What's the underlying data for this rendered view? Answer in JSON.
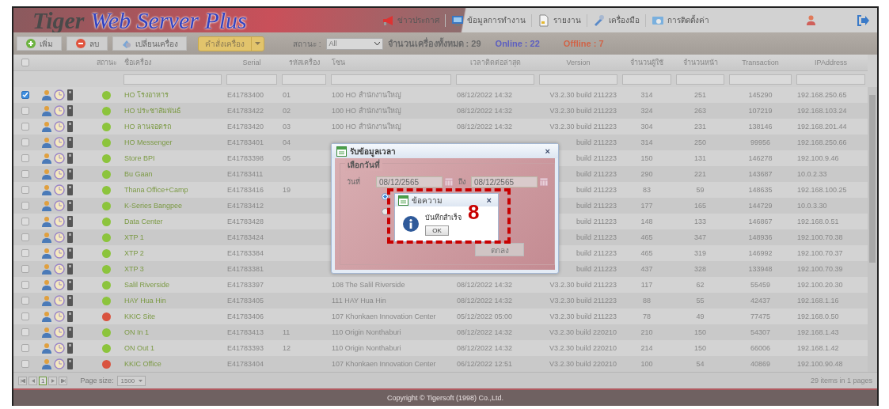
{
  "header": {
    "logo_part1": "Tiger",
    "logo_part2": "Web Server Plus",
    "nav": [
      {
        "label": "ข่าวประกาศ",
        "kind": "megaphone"
      },
      {
        "label": "ข้อมูลการทำงาน",
        "kind": "monitor"
      },
      {
        "label": "รายงาน",
        "kind": "document"
      },
      {
        "label": "เครื่องมือ",
        "kind": "tools"
      },
      {
        "label": "การติดตั้งค่า",
        "kind": "settings"
      }
    ]
  },
  "toolbar": {
    "buttons": [
      {
        "label": "เพิ่ม",
        "kind": "add"
      },
      {
        "label": "ลบ",
        "kind": "remove"
      },
      {
        "label": "เปลี่ยนเครื่อง",
        "kind": "swap"
      }
    ],
    "command_button": "คำสั่งเครื่อง",
    "status_label": "สถานะ :",
    "status_value": "All",
    "total": "จำนวนเครื่องทั้งหมด : 29",
    "online": "Online : 22",
    "offline": "Offline : 7"
  },
  "table": {
    "header_checkbox": {
      "checked": false
    },
    "status_column": "สถานะ",
    "columns": [
      "ชื่อเครื่อง",
      "Serial",
      "รหัสเครื่อง",
      "โซน",
      "เวลาติดต่อล่าสุด",
      "Version",
      "จำนวนผู้ใช้",
      "จำนวนหน้า",
      "Transaction",
      "IPAddress"
    ],
    "rows": [
      {
        "checked": true,
        "color": "#8cc43c",
        "cells": [
          "HO โรงอาหาร",
          "E41783400",
          "01",
          "100 HO สำนักงานใหญ่",
          "08/12/2022 14:32",
          "V3.2.30 build 211223",
          "314",
          "251",
          "145290",
          "192.168.250.65"
        ]
      },
      {
        "checked": false,
        "color": "#8cc43c",
        "cells": [
          "HO ประชาสัมพันธ์",
          "E41783422",
          "02",
          "100 HO สำนักงานใหญ่",
          "08/12/2022 14:32",
          "V3.2.30 build 211223",
          "324",
          "263",
          "107219",
          "192.168.103.24"
        ]
      },
      {
        "checked": false,
        "color": "#8cc43c",
        "cells": [
          "HO ลานจอดรถ",
          "E41783420",
          "03",
          "100 HO สำนักงานใหญ่",
          "08/12/2022 14:32",
          "V3.2.30 build 211223",
          "304",
          "231",
          "138146",
          "192.168.201.44"
        ]
      },
      {
        "checked": false,
        "color": "#8cc43c",
        "cells": [
          "HO Messenger",
          "E41783401",
          "04",
          null,
          null,
          "build 211223",
          "314",
          "250",
          "99956",
          "192.168.250.66"
        ]
      },
      {
        "checked": false,
        "color": "#8cc43c",
        "cells": [
          "Store BPI",
          "E41783398",
          "05",
          null,
          null,
          "build 211223",
          "150",
          "131",
          "146278",
          "192.100.9.46"
        ]
      },
      {
        "checked": false,
        "color": "#8cc43c",
        "cells": [
          "Bu Gaan",
          "E41783411",
          null,
          null,
          null,
          "build 211223",
          "290",
          "221",
          "143687",
          "10.0.2.33"
        ]
      },
      {
        "checked": false,
        "color": "#8cc43c",
        "cells": [
          "Thana Office+Camp",
          "E41783416",
          "19",
          null,
          null,
          "build 211223",
          "83",
          "59",
          "148635",
          "192.168.100.25"
        ]
      },
      {
        "checked": false,
        "color": "#8cc43c",
        "cells": [
          "K-Series Bangpee",
          "E41783412",
          null,
          null,
          null,
          "build 211223",
          "177",
          "165",
          "144729",
          "10.0.3.30"
        ]
      },
      {
        "checked": false,
        "color": "#8cc43c",
        "cells": [
          "Data Center",
          "E41783428",
          null,
          null,
          null,
          "build 211223",
          "148",
          "133",
          "146867",
          "192.168.0.51"
        ]
      },
      {
        "checked": false,
        "color": "#8cc43c",
        "cells": [
          "XTP 1",
          "E41783424",
          null,
          null,
          null,
          "build 211223",
          "465",
          "347",
          "148936",
          "192.100.70.38"
        ]
      },
      {
        "checked": false,
        "color": "#8cc43c",
        "cells": [
          "XTP 2",
          "E41783384",
          null,
          null,
          null,
          "build 211223",
          "465",
          "319",
          "146992",
          "192.100.70.37"
        ]
      },
      {
        "checked": false,
        "color": "#8cc43c",
        "cells": [
          "XTP 3",
          "E41783381",
          null,
          null,
          null,
          "build 211223",
          "437",
          "328",
          "133948",
          "192.100.70.39"
        ]
      },
      {
        "checked": false,
        "color": "#8cc43c",
        "cells": [
          "Salil Riverside",
          "E41783397",
          null,
          "108 The Salil Riverside",
          "08/12/2022 14:32",
          "V3.2.30 build 211223",
          "117",
          "62",
          "55459",
          "192.100.20.30"
        ]
      },
      {
        "checked": false,
        "color": "#8cc43c",
        "cells": [
          "HAY Hua Hin",
          "E41783405",
          null,
          "111 HAY Hua Hin",
          "08/12/2022 14:32",
          "V3.2.30 build 211223",
          "88",
          "55",
          "42437",
          "192.168.1.16"
        ]
      },
      {
        "checked": false,
        "color": "#d9533f",
        "cells": [
          "KKIC Site",
          "E41783406",
          null,
          "107 Khonkaen Innovation Center",
          "05/12/2022 05:00",
          "V3.2.30 build 211223",
          "78",
          "49",
          "77475",
          "192.168.0.50"
        ]
      },
      {
        "checked": false,
        "color": "#8cc43c",
        "cells": [
          "ON In 1",
          "E41783413",
          "11",
          "110 Origin Nonthaburi",
          "08/12/2022 14:32",
          "V3.2.30 build 220210",
          "210",
          "150",
          "54307",
          "192.168.1.43"
        ]
      },
      {
        "checked": false,
        "color": "#8cc43c",
        "cells": [
          "ON Out 1",
          "E41783393",
          "12",
          "110 Origin Nonthaburi",
          "08/12/2022 14:32",
          "V3.2.30 build 220210",
          "214",
          "150",
          "66006",
          "192.168.1.42"
        ]
      },
      {
        "checked": false,
        "color": "#d9533f",
        "cells": [
          "KKIC Office",
          "E41783404",
          null,
          "107 Khonkaen Innovation Center",
          "06/12/2022 12:51",
          "V3.2.30 build 220210",
          "100",
          "54",
          "40869",
          "192.100.90.48"
        ]
      }
    ]
  },
  "pager": {
    "page": "1",
    "page_size_label": "Page size:",
    "page_size": "1500",
    "summary": "29 items in 1 pages"
  },
  "footer": "Copyright © Tigersoft (1998) Co.,Ltd.",
  "dialog": {
    "title": "รับข้อมูลเวลา",
    "close": "×",
    "group_label": "เลือกวันที่",
    "date_label": "วันที่",
    "date_from": "08/12/2565",
    "to_label": "ถึง",
    "date_to": "08/12/2565",
    "options": [
      {
        "selected": true
      },
      {
        "selected": false
      }
    ],
    "ok_button": "ตกลง"
  },
  "message_box": {
    "title": "ข้อความ",
    "close": "×",
    "text": "บันทึกสำเร็จ",
    "button": "OK"
  },
  "annotation": {
    "label": "8"
  }
}
